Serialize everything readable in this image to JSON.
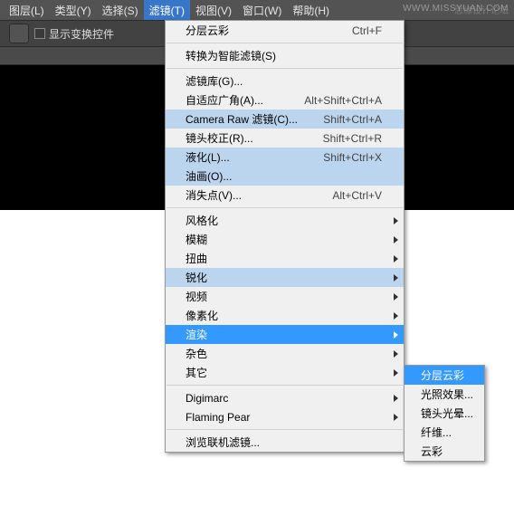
{
  "watermark": "WWW.MISSYUAN.COM",
  "menubar": [
    {
      "l": "图层(L)"
    },
    {
      "l": "类型(Y)"
    },
    {
      "l": "选择(S)"
    },
    {
      "l": "滤镜(T)",
      "open": true
    },
    {
      "l": "视图(V)"
    },
    {
      "l": "窗口(W)"
    },
    {
      "l": "帮助(H)"
    }
  ],
  "forum_badge": "思缘设计论坛",
  "toolbar": {
    "checkbox_label": "显示变换控件"
  },
  "menu": [
    {
      "t": "item",
      "l": "分层云彩",
      "sc": "Ctrl+F"
    },
    {
      "t": "sep"
    },
    {
      "t": "item",
      "l": "转换为智能滤镜(S)"
    },
    {
      "t": "sep"
    },
    {
      "t": "item",
      "l": "滤镜库(G)..."
    },
    {
      "t": "item",
      "l": "自适应广角(A)...",
      "sc": "Alt+Shift+Ctrl+A"
    },
    {
      "t": "item",
      "l": "Camera Raw 滤镜(C)...",
      "sc": "Shift+Ctrl+A",
      "hl": true
    },
    {
      "t": "item",
      "l": "镜头校正(R)...",
      "sc": "Shift+Ctrl+R"
    },
    {
      "t": "item",
      "l": "液化(L)...",
      "sc": "Shift+Ctrl+X",
      "hl": true
    },
    {
      "t": "item",
      "l": "油画(O)...",
      "hl": true
    },
    {
      "t": "item",
      "l": "消失点(V)...",
      "sc": "Alt+Ctrl+V"
    },
    {
      "t": "sep"
    },
    {
      "t": "item",
      "l": "风格化",
      "sub": true
    },
    {
      "t": "item",
      "l": "模糊",
      "sub": true
    },
    {
      "t": "item",
      "l": "扭曲",
      "sub": true
    },
    {
      "t": "item",
      "l": "锐化",
      "sub": true,
      "hl": true
    },
    {
      "t": "item",
      "l": "视频",
      "sub": true
    },
    {
      "t": "item",
      "l": "像素化",
      "sub": true
    },
    {
      "t": "item",
      "l": "渲染",
      "sub": true,
      "sel": true
    },
    {
      "t": "item",
      "l": "杂色",
      "sub": true
    },
    {
      "t": "item",
      "l": "其它",
      "sub": true
    },
    {
      "t": "sep"
    },
    {
      "t": "item",
      "l": "Digimarc",
      "sub": true
    },
    {
      "t": "item",
      "l": "Flaming Pear",
      "sub": true
    },
    {
      "t": "sep"
    },
    {
      "t": "item",
      "l": "浏览联机滤镜..."
    }
  ],
  "submenu": [
    {
      "l": "分层云彩",
      "sel": true
    },
    {
      "l": "光照效果..."
    },
    {
      "l": "镜头光晕..."
    },
    {
      "l": "纤维..."
    },
    {
      "l": "云彩"
    }
  ]
}
